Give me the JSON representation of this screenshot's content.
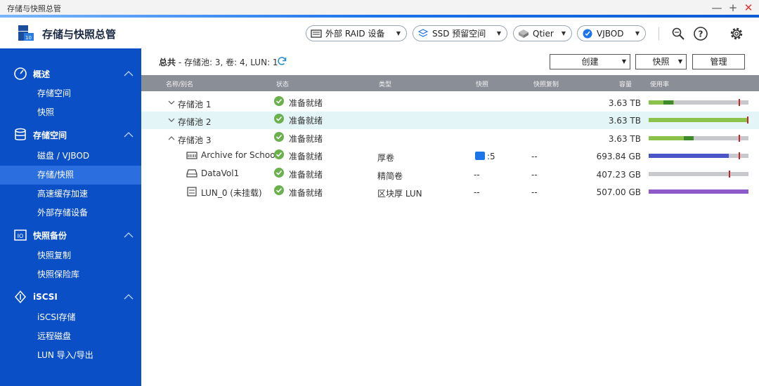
{
  "window": {
    "title": "存储与快照总管",
    "minimize_label": "—",
    "maximize_label": "+",
    "close_label": "✕"
  },
  "header": {
    "app_title": "存储与快照总管",
    "buttons": {
      "external_raid": "外部 RAID 设备",
      "ssd": "SSD 预留空间",
      "qtier": "Qtier",
      "vjbod": "VJBOD"
    },
    "icons": [
      "inspect-icon",
      "help-icon",
      "settings-icon"
    ]
  },
  "sidebar": {
    "groups": [
      {
        "label": "概述",
        "items": [
          "存储空间",
          "快照"
        ]
      },
      {
        "label": "存储空间",
        "items": [
          "磁盘 / VJBOD",
          "存储/快照",
          "高速缓存加速",
          "外部存储设备"
        ]
      },
      {
        "label": "快照备份",
        "items": [
          "快照复制",
          "快照保险库"
        ]
      },
      {
        "label": "iSCSI",
        "items": [
          "iSCSI存储",
          "远程磁盘",
          "LUN 导入/导出"
        ]
      }
    ],
    "active_item": "存储/快照"
  },
  "main": {
    "summary": {
      "prefix": "总共",
      "detail": " - 存储池: 3, 卷: 4, LUN: 1"
    },
    "actions": {
      "create": "创建",
      "snapshot": "快照",
      "manage": "管理"
    },
    "columns": {
      "name": "名称/别名",
      "status": "状态",
      "type": "类型",
      "snapshot": "快照",
      "snapshot_replica": "快照复制",
      "capacity": "容量",
      "usage": "使用率"
    },
    "rows": [
      {
        "name": "存储池 1",
        "status": "准备就绪",
        "type": "",
        "snapshot": "",
        "replica": "",
        "capacity": "3.63 TB"
      },
      {
        "name": "存储池 2",
        "status": "准备就绪",
        "type": "",
        "snapshot": "",
        "replica": "",
        "capacity": "3.63 TB"
      },
      {
        "name": "存储池 3",
        "status": "准备就绪",
        "type": "",
        "snapshot": "",
        "replica": "",
        "capacity": "3.63 TB"
      },
      {
        "name": "Archive for School",
        "status": "准备就绪",
        "type": "厚卷",
        "snapshot": ":5",
        "replica": "--",
        "capacity": "693.84 GB"
      },
      {
        "name": "DataVol1",
        "status": "准备就绪",
        "type": "精简卷",
        "snapshot": "--",
        "replica": "--",
        "capacity": "407.23 GB"
      },
      {
        "name": "LUN_0 (未挂载)",
        "status": "准备就绪",
        "type": "区块厚 LUN",
        "snapshot": "--",
        "replica": "--",
        "capacity": "507.00 GB"
      }
    ],
    "usage_bars": [
      {
        "fill": 0.25,
        "color": "#8bc34a",
        "dark_from": 0.15,
        "dark_to": 0.25,
        "threshold": 0.9
      },
      {
        "fill": 1.0,
        "color": "#8bc34a",
        "threshold": 1.0
      },
      {
        "fill": 0.45,
        "color": "#8bc34a",
        "dark_from": 0.35,
        "dark_to": 0.45,
        "threshold": 0.9
      },
      {
        "fill": 0.8,
        "color": "#4a56c8",
        "threshold": 0.9
      },
      {
        "fill": 0.0,
        "color": "#4a56c8",
        "threshold": 0.8
      },
      {
        "fill": 1.0,
        "color": "#8e59c9"
      }
    ]
  },
  "colors": {
    "sidebar_bg": "#0b4fc6",
    "sidebar_active": "#2b6ee0",
    "status_ready": "#6ab04c",
    "highlight_row": "#e3f5f7"
  }
}
